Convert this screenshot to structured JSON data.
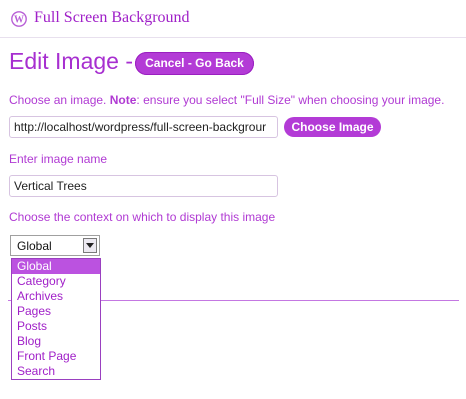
{
  "header": {
    "title": "Full Screen Background",
    "logo_icon": "wordpress-logo-icon"
  },
  "page": {
    "title": "Edit Image -",
    "cancel_button": "Cancel - Go Back"
  },
  "image_section": {
    "instruction_prefix": "Choose an image.",
    "instruction_note_label": "Note",
    "instruction_suffix": ": ensure you select \"Full Size\" when choosing your image.",
    "url_value": "http://localhost/wordpress/full-screen-backgrour",
    "choose_button": "Choose Image"
  },
  "name_section": {
    "label": "Enter image name",
    "value": "Vertical Trees"
  },
  "context_section": {
    "label": "Choose the context on which to display this image",
    "selected": "Global",
    "options": [
      "Global",
      "Category",
      "Archives",
      "Pages",
      "Posts",
      "Blog",
      "Front Page",
      "Search"
    ]
  },
  "colors": {
    "accent": "#b33bd6",
    "text_purple": "#b03ad3",
    "highlight": "#bb52e0"
  }
}
